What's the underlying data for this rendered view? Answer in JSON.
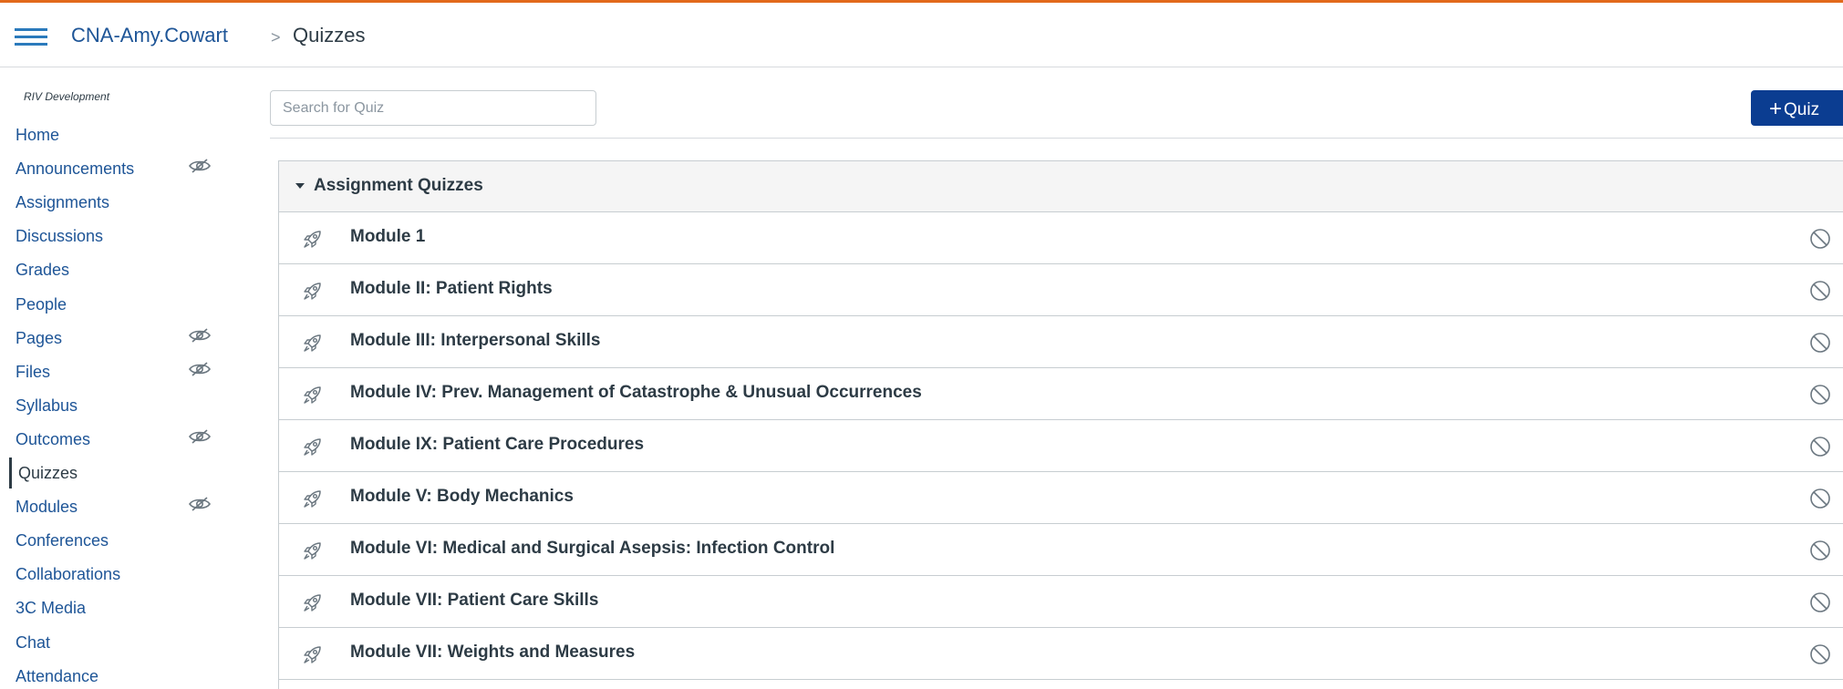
{
  "header": {
    "course_name": "CNA-Amy.Cowart",
    "separator": ">",
    "current_page": "Quizzes"
  },
  "sidebar": {
    "term": "RIV Development",
    "items": [
      {
        "label": "Home",
        "hidden": false,
        "active": false
      },
      {
        "label": "Announcements",
        "hidden": true,
        "active": false
      },
      {
        "label": "Assignments",
        "hidden": false,
        "active": false
      },
      {
        "label": "Discussions",
        "hidden": false,
        "active": false
      },
      {
        "label": "Grades",
        "hidden": false,
        "active": false
      },
      {
        "label": "People",
        "hidden": false,
        "active": false
      },
      {
        "label": "Pages",
        "hidden": true,
        "active": false
      },
      {
        "label": "Files",
        "hidden": true,
        "active": false
      },
      {
        "label": "Syllabus",
        "hidden": false,
        "active": false
      },
      {
        "label": "Outcomes",
        "hidden": true,
        "active": false
      },
      {
        "label": "Quizzes",
        "hidden": false,
        "active": true
      },
      {
        "label": "Modules",
        "hidden": true,
        "active": false
      },
      {
        "label": "Conferences",
        "hidden": false,
        "active": false
      },
      {
        "label": "Collaborations",
        "hidden": false,
        "active": false
      },
      {
        "label": "3C Media",
        "hidden": false,
        "active": false
      },
      {
        "label": "Chat",
        "hidden": false,
        "active": false
      },
      {
        "label": "Attendance",
        "hidden": false,
        "active": false
      }
    ]
  },
  "toolbar": {
    "search_placeholder": "Search for Quiz",
    "add_quiz_label": "Quiz",
    "add_quiz_plus": "+"
  },
  "quiz_group": {
    "title": "Assignment Quizzes",
    "quizzes": [
      {
        "title": "Module 1"
      },
      {
        "title": "Module II: Patient Rights"
      },
      {
        "title": "Module III: Interpersonal Skills"
      },
      {
        "title": "Module IV: Prev. Management of Catastrophe & Unusual Occurrences"
      },
      {
        "title": "Module IX: Patient Care Procedures"
      },
      {
        "title": "Module V: Body Mechanics"
      },
      {
        "title": "Module VI: Medical and Surgical Asepsis: Infection Control"
      },
      {
        "title": "Module VII: Patient Care Skills"
      },
      {
        "title": "Module VII: Weights and Measures"
      }
    ]
  },
  "colors": {
    "top_border": "#e2691c",
    "link": "#1e5597",
    "primary_button": "#0b3d91",
    "text": "#2d3b45"
  }
}
